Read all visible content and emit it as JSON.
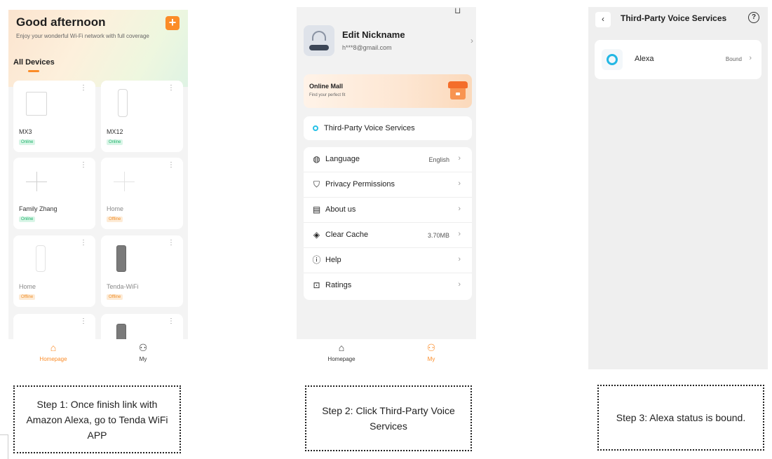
{
  "screen1": {
    "greeting": "Good afternoon",
    "subtitle": "Enjoy your wonderful Wi-Fi network with full coverage",
    "add_icon": "plus-icon",
    "section_title": "All Devices",
    "devices": [
      {
        "name": "MX3",
        "status": "Online"
      },
      {
        "name": "MX12",
        "status": "Online"
      },
      {
        "name": "Family Zhang",
        "status": "Online"
      },
      {
        "name": "Home",
        "status": "Offline"
      },
      {
        "name": "Home",
        "status": "Offline"
      },
      {
        "name": "Tenda-WiFi",
        "status": "Offline"
      }
    ],
    "tabs": [
      {
        "label": "Homepage",
        "icon": "home-icon",
        "active": true
      },
      {
        "label": "My",
        "icon": "user-icon",
        "active": false
      }
    ]
  },
  "screen2": {
    "profile": {
      "name": "Edit Nickname",
      "email": "h***8@gmail.com"
    },
    "mall": {
      "title": "Online Mall",
      "subtitle": "Find your perfect fit"
    },
    "voice_services": "Third-Party Voice Services",
    "settings": [
      {
        "label": "Language",
        "value": "English",
        "icon": "globe-icon"
      },
      {
        "label": "Privacy Permissions",
        "value": "",
        "icon": "shield-icon"
      },
      {
        "label": "About us",
        "value": "",
        "icon": "book-icon"
      },
      {
        "label": "Clear Cache",
        "value": "3.70MB",
        "icon": "eraser-icon"
      },
      {
        "label": "Help",
        "value": "",
        "icon": "info-icon"
      },
      {
        "label": "Ratings",
        "value": "",
        "icon": "star-message-icon"
      }
    ],
    "tabs": [
      {
        "label": "Homepage",
        "icon": "home-icon",
        "active": false
      },
      {
        "label": "My",
        "icon": "user-icon",
        "active": true
      }
    ]
  },
  "screen3": {
    "title": "Third-Party Voice Services",
    "service": {
      "name": "Alexa",
      "status": "Bound"
    }
  },
  "captions": {
    "step1": "Step 1: Once finish link with Amazon Alexa, go to Tenda WiFi APP",
    "step2": "Step 2: Click Third-Party Voice Services",
    "step3": "Step 3: Alexa status is bound."
  },
  "colors": {
    "accent": "#fb8c28",
    "online": "#1fb36b",
    "offline": "#f0902c",
    "alexa": "#22b7e4"
  }
}
